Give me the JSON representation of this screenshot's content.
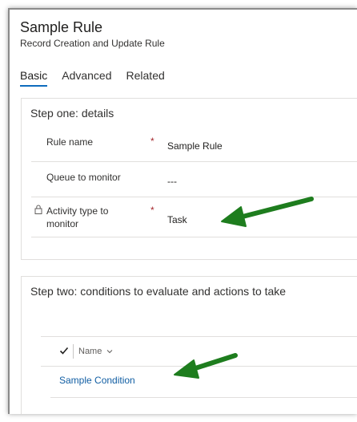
{
  "header": {
    "title": "Sample Rule",
    "subtitle": "Record Creation and Update Rule"
  },
  "tabs": [
    {
      "label": "Basic",
      "active": true
    },
    {
      "label": "Advanced",
      "active": false
    },
    {
      "label": "Related",
      "active": false
    }
  ],
  "step_one": {
    "title": "Step one: details",
    "fields": [
      {
        "label": "Rule name",
        "required": "*",
        "value": "Sample Rule"
      },
      {
        "label": "Queue to monitor",
        "value": "---"
      },
      {
        "label": "Activity type to monitor",
        "required": "*",
        "value": "Task",
        "locked": true
      }
    ]
  },
  "step_two": {
    "title": "Step two: conditions to evaluate and actions to take",
    "grid": {
      "column_header": "Name",
      "rows": [
        {
          "name": "Sample Condition"
        }
      ]
    }
  },
  "colors": {
    "accent": "#0f6cbd",
    "link": "#115ea3",
    "required": "#a4262c",
    "annotation_arrow": "#1e7d1e"
  },
  "icons": {
    "lock": "lock-icon",
    "check": "checkmark-icon",
    "sort": "chevron-down-icon",
    "annotation": "arrow-icon"
  }
}
